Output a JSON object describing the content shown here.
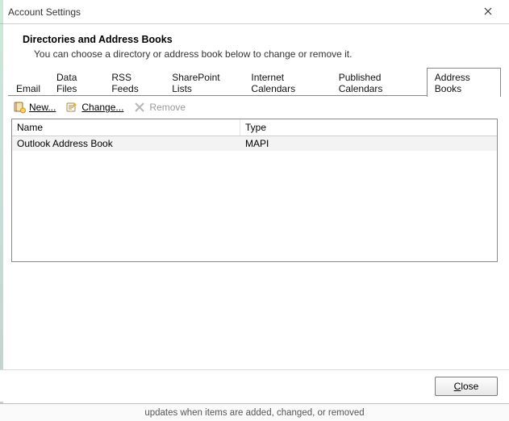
{
  "window": {
    "title": "Account Settings",
    "close_label": "Close window"
  },
  "heading": {
    "title": "Directories and Address Books",
    "subtitle": "You can choose a directory or address book below to change or remove it."
  },
  "tabs": [
    {
      "label": "Email",
      "active": false
    },
    {
      "label": "Data Files",
      "active": false
    },
    {
      "label": "RSS Feeds",
      "active": false
    },
    {
      "label": "SharePoint Lists",
      "active": false
    },
    {
      "label": "Internet Calendars",
      "active": false
    },
    {
      "label": "Published Calendars",
      "active": false
    },
    {
      "label": "Address Books",
      "active": true
    }
  ],
  "toolbar": {
    "new_label": "New...",
    "change_label": "Change...",
    "remove_label": "Remove",
    "remove_enabled": false
  },
  "list": {
    "columns": {
      "name": "Name",
      "type": "Type"
    },
    "rows": [
      {
        "name": "Outlook Address Book",
        "type": "MAPI"
      }
    ]
  },
  "footer": {
    "close_label": "Close",
    "close_accel": "C"
  },
  "cutoff_text": "updates when items are added, changed, or removed"
}
